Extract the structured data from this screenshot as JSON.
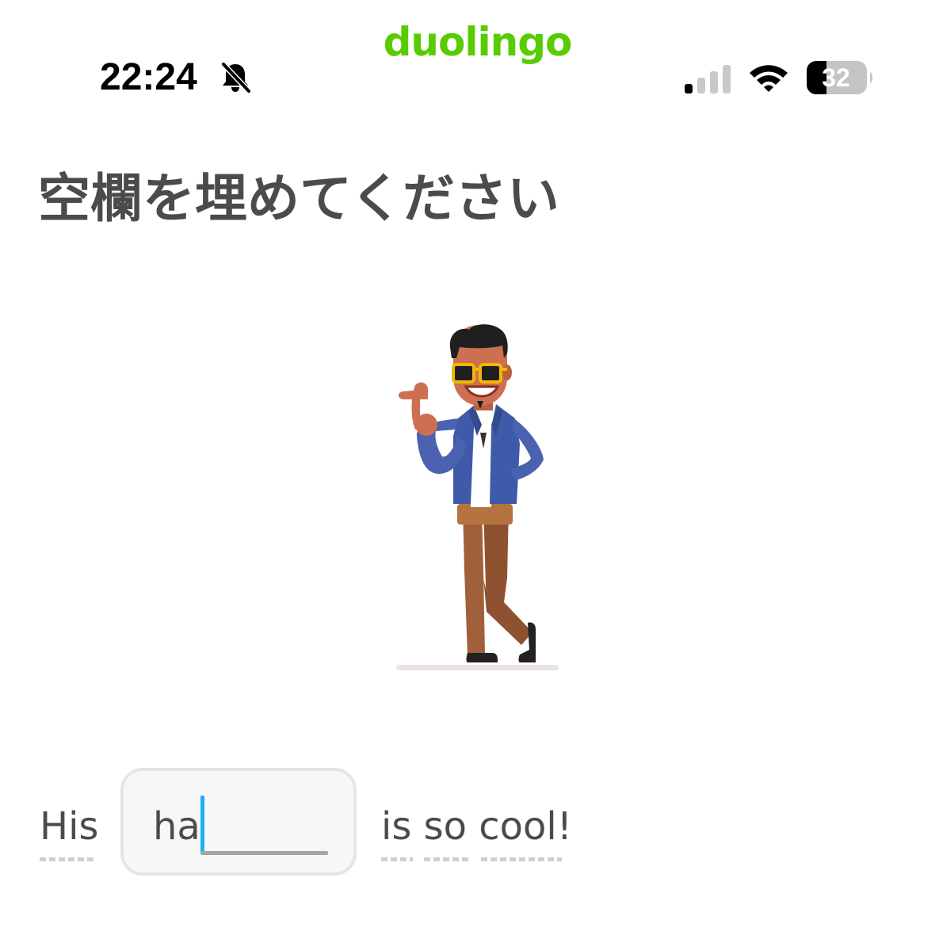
{
  "app": {
    "brand": "duolingo",
    "brand_color": "#58cc02"
  },
  "status_bar": {
    "time": "22:24",
    "mute_icon": "bell-slash-icon",
    "cellular_icon": "cellular-signal-icon",
    "cellular_bars": 1,
    "wifi_icon": "wifi-icon",
    "battery_icon": "battery-icon",
    "battery_level": "32"
  },
  "exercise": {
    "instruction": "空欄を埋めてください",
    "illustration": "man-in-sunglasses-pointing",
    "sentence_before": "His",
    "answer_typed": "ha",
    "sentence_after": "is so cool!"
  },
  "colors": {
    "text": "#4b4b4b",
    "caret": "#1cb0f6",
    "input_bg": "#f7f7f7",
    "input_border": "#e5e5e5"
  }
}
